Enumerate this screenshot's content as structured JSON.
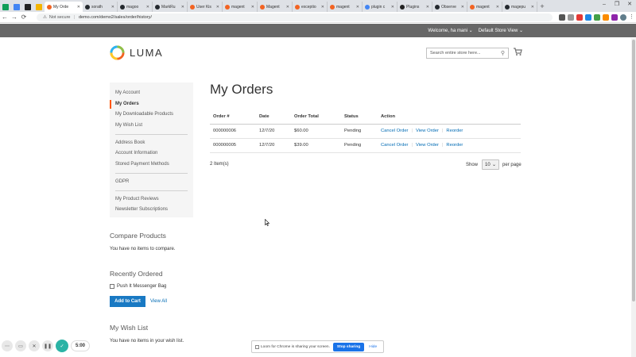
{
  "browser": {
    "tabs": [
      {
        "label": "My Orde",
        "color": "#f26322",
        "active": true
      },
      {
        "label": "sorath",
        "color": "#24292e"
      },
      {
        "label": "magoo",
        "color": "#24292e"
      },
      {
        "label": "MarkRu",
        "color": "#24292e"
      },
      {
        "label": "User Kis",
        "color": "#f26322"
      },
      {
        "label": "magent",
        "color": "#f26322"
      },
      {
        "label": "Magent",
        "color": "#f26322"
      },
      {
        "label": "exceptio",
        "color": "#f26322"
      },
      {
        "label": "magent",
        "color": "#f26322"
      },
      {
        "label": "plugin c",
        "color": "#4285f4"
      },
      {
        "label": "Plugins",
        "color": "#222222"
      },
      {
        "label": "Observe",
        "color": "#24292e"
      },
      {
        "label": "magent",
        "color": "#f26322"
      },
      {
        "label": "magepu",
        "color": "#24292e"
      }
    ],
    "new_tab": "+",
    "security_label": "Not secure",
    "url": "demo.com/demo2/sales/order/history/"
  },
  "header": {
    "welcome": "Welcome, ha mani",
    "store_view": "Default Store View",
    "logo_text": "LUMA",
    "search_placeholder": "Search entire store here..."
  },
  "sidebar": {
    "groups": [
      [
        "My Account",
        "My Orders",
        "My Downloadable Products",
        "My Wish List"
      ],
      [
        "Address Book",
        "Account Information",
        "Stored Payment Methods"
      ],
      [
        "GDPR"
      ],
      [
        "My Product Reviews",
        "Newsletter Subscriptions"
      ]
    ],
    "current": "My Orders"
  },
  "compare": {
    "title": "Compare Products",
    "empty": "You have no items to compare."
  },
  "recently_ordered": {
    "title": "Recently Ordered",
    "item": "Push It Messenger Bag",
    "add_to_cart": "Add to Cart",
    "view_all": "View All"
  },
  "wishlist": {
    "title": "My Wish List",
    "empty": "You have no items in your wish list."
  },
  "main": {
    "title": "My Orders",
    "columns": [
      "Order #",
      "Date",
      "Order Total",
      "Status",
      "Action"
    ],
    "orders": [
      {
        "id": "000000006",
        "date": "12/7/20",
        "total": "$60.00",
        "status": "Pending"
      },
      {
        "id": "000000005",
        "date": "12/7/20",
        "total": "$39.00",
        "status": "Pending"
      }
    ],
    "actions": [
      "Cancel Order",
      "View Order",
      "Reorder"
    ],
    "items_count": "2 Item(s)",
    "show_label": "Show",
    "limit": "10",
    "per_page": "per page"
  },
  "loom": {
    "timer": "5:00",
    "share_text": "Loom for Chrome is sharing your screen.",
    "stop_sharing": "Stop sharing",
    "hide": "Hide"
  },
  "colors": {
    "accent": "#ff5501",
    "button_blue": "#1979c3",
    "link": "#006bb4",
    "panel_bar": "#676767"
  }
}
